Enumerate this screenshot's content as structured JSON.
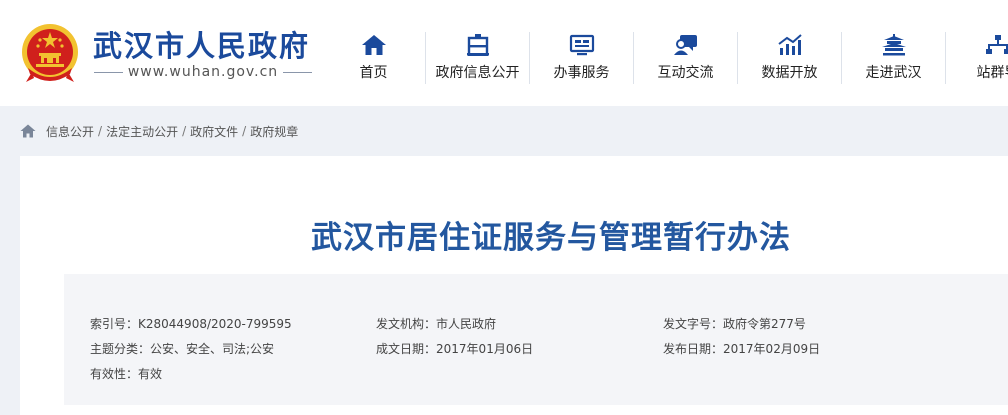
{
  "header": {
    "site_name": "武汉市人民政府",
    "site_domain": "www.wuhan.gov.cn"
  },
  "nav": {
    "items": [
      {
        "label": "首页",
        "icon": "home-icon"
      },
      {
        "label": "政府信息公开",
        "icon": "gov-info-icon"
      },
      {
        "label": "办事服务",
        "icon": "service-icon"
      },
      {
        "label": "互动交流",
        "icon": "interaction-icon"
      },
      {
        "label": "数据开放",
        "icon": "data-chart-icon"
      },
      {
        "label": "走进武汉",
        "icon": "pavilion-icon"
      },
      {
        "label": "站群导",
        "icon": "sitemap-icon"
      }
    ]
  },
  "breadcrumb": [
    "信息公开",
    "法定主动公开",
    "政府文件",
    "政府规章"
  ],
  "document": {
    "title": "武汉市居住证服务与管理暂行办法",
    "meta": {
      "index_label": "索引号：",
      "index_value": "K28044908/2020-799595",
      "issuer_label": "发文机构：",
      "issuer_value": "市人民政府",
      "doc_no_label": "发文字号：",
      "doc_no_value": "政府令第277号",
      "topic_label": "主题分类：",
      "topic_value": "公安、安全、司法;公安",
      "written_label": "成文日期：",
      "written_value": "2017年01月06日",
      "published_label": "发布日期：",
      "published_value": "2017年02月09日",
      "validity_label": "有效性：",
      "validity_value": "有效"
    }
  },
  "colors": {
    "brand_blue": "#1b4a9c",
    "title_blue": "#23579f",
    "emblem_red": "#d0201c",
    "emblem_gold": "#f2c230"
  }
}
